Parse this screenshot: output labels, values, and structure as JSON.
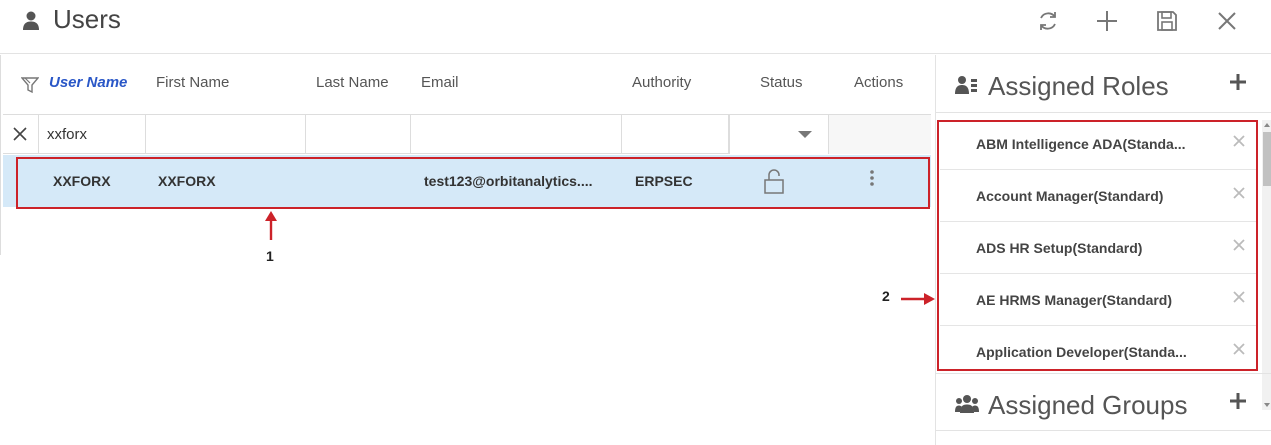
{
  "header": {
    "title": "Users",
    "icons": [
      "user-icon",
      "refresh-icon",
      "add-icon",
      "save-icon",
      "close-icon"
    ]
  },
  "table": {
    "columns": [
      "User Name",
      "First Name",
      "Last Name",
      "Email",
      "Authority",
      "Status",
      "Actions"
    ],
    "sorted_column": "User Name",
    "filters": {
      "user_name": "xxforx",
      "first_name": "",
      "last_name": "",
      "email": "",
      "authority": "",
      "status": ""
    },
    "rows": [
      {
        "user_name": "XXFORX",
        "first_name": "XXFORX",
        "last_name": "",
        "email": "test123@orbitanalytics....",
        "authority": "ERPSEC",
        "status_icon": "unlock-icon",
        "actions_icon": "more-vertical-icon"
      }
    ]
  },
  "annotations": {
    "label1": "1",
    "label2": "2",
    "color": "#cc2229"
  },
  "assigned_roles": {
    "title": "Assigned Roles",
    "items": [
      "ABM Intelligence ADA(Standa...",
      "Account Manager(Standard)",
      "ADS HR Setup(Standard)",
      "AE HRMS Manager(Standard)",
      "Application Developer(Standa..."
    ]
  },
  "assigned_groups": {
    "title": "Assigned Groups"
  },
  "colors": {
    "selected_row": "#d5e9f8",
    "sorted_header": "#2a57c7"
  }
}
